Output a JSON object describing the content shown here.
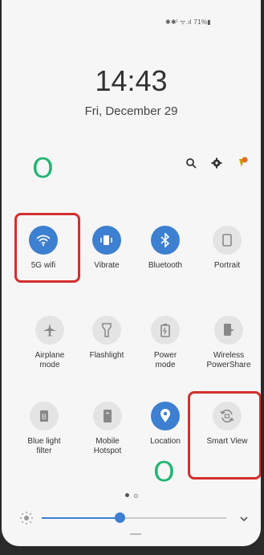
{
  "status_bar": {
    "text": "✱✱ᴵ ᯤ.ıl 71%▮"
  },
  "clock": {
    "time": "14:43",
    "date": "Fri, December 29"
  },
  "top_actions": [
    {
      "icon": "search-icon"
    },
    {
      "icon": "gear-icon"
    },
    {
      "icon": "notification-icon"
    }
  ],
  "tiles": [
    {
      "label": "5G wifi",
      "icon": "wifi-icon",
      "state": "on"
    },
    {
      "label": "Vibrate",
      "icon": "vibrate-icon",
      "state": "on"
    },
    {
      "label": "Bluetooth",
      "icon": "bluetooth-icon",
      "state": "on"
    },
    {
      "label": "Portrait",
      "icon": "portrait-icon",
      "state": "off"
    },
    {
      "label": "Airplane\nmode",
      "icon": "airplane-icon",
      "state": "off"
    },
    {
      "label": "Flashlight",
      "icon": "flashlight-icon",
      "state": "off"
    },
    {
      "label": "Power\nmode",
      "icon": "battery-icon",
      "state": "off"
    },
    {
      "label": "Wireless\nPowerShare",
      "icon": "powershare-icon",
      "state": "off"
    },
    {
      "label": "Blue light\nfilter",
      "icon": "blue-light-icon",
      "state": "off"
    },
    {
      "label": "Mobile\nHotspot",
      "icon": "hotspot-icon",
      "state": "off"
    },
    {
      "label": "Location",
      "icon": "location-icon",
      "state": "on"
    },
    {
      "label": "Smart View",
      "icon": "smart-view-icon",
      "state": "off"
    }
  ],
  "annotations": [
    {
      "text": "O",
      "color": "#22b573"
    },
    {
      "text": "O",
      "color": "#22b573"
    }
  ],
  "colors": {
    "accent": "#3d7fd0",
    "highlight": "#d32f2f",
    "annotation": "#22b573"
  },
  "pager": {
    "current": 1,
    "total": 2
  },
  "brightness": {
    "level": 0.42
  }
}
